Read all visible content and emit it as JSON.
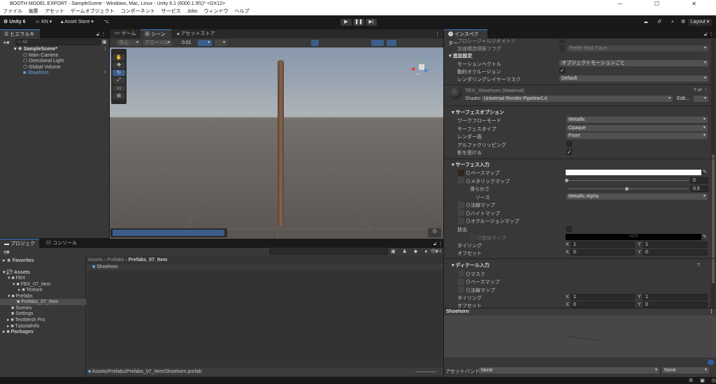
{
  "window": {
    "title": "BOOTH MODEL EXPORT - SampleScene - Windows, Mac, Linux - Unity 6.1 (6000.1.5f1)* <DX12>",
    "controls": "─ ☐ ✕"
  },
  "menu": [
    "ファイル",
    "編集",
    "アセット",
    "ゲームオブジェクト",
    "コンポーネント",
    "サービス",
    "Jobs",
    "ウィンドウ",
    "ヘルプ"
  ],
  "toolbar": {
    "unity": "Unity 6",
    "account": "KN ▾",
    "asset_store": "Asset Store ▾",
    "layout": "Layout ▾"
  },
  "hierarchy": {
    "tab": "ヒエラルキー",
    "search_placeholder": "All",
    "scene": "SampleScene*",
    "items": [
      "Main Camera",
      "Directional Light",
      "Global Volume",
      "Shoehorn"
    ]
  },
  "scene": {
    "tabs": [
      "ゲーム",
      "シーン",
      "アセットストア"
    ],
    "pivot": "中心",
    "space": "グローバル",
    "snap": "0.01"
  },
  "project": {
    "tabs": [
      "プロジェクト",
      "コンソール"
    ],
    "tree": {
      "favorites": "Favorites",
      "assets": "Assets",
      "fbx": "FBX",
      "fbx_item": "FBX_07_Item",
      "texture": "Texture",
      "prefabs": "Prefabs",
      "prefabs_item": "Prefabs_07_Item",
      "scenes": "Scenes",
      "settings": "Settings",
      "textmesh": "TextMesh Pro",
      "tutorial": "TutorialInfo",
      "packages": "Packages"
    },
    "breadcrumb": [
      "Assets",
      "Prefabs",
      "Prefabs_07_Item"
    ],
    "asset": "Shoehorn",
    "path": "Assets/Prefabs/Prefabs_07_Item/Shoehorn.prefab",
    "count": "24"
  },
  "inspector": {
    "tab": "インスペクター",
    "procedural": "プロシージャルジオメトリ",
    "accel": "加速構造構築フラグ",
    "accel_value": "Prefer Fast Trace",
    "additional": "追加設定",
    "motion": "モーションベクトル",
    "motion_value": "オブジェクトモーションごと",
    "occlusion": "動的オクルージョン",
    "layer_mask": "レンダリングレイヤーマスク",
    "layer_mask_value": "Default",
    "material": "TEX_Shoehorn (Material)",
    "shader_label": "Shader",
    "shader": "Universal Render Pipeline/Lit",
    "edit": "Edit...",
    "surface_options": "サーフェスオプション",
    "workflow": "ワークフローモード",
    "workflow_value": "Metallic",
    "surface_type": "サーフェスタイプ",
    "surface_type_value": "Opaque",
    "render_face": "レンダー面",
    "render_face_value": "Front",
    "alpha_clip": "アルファクリッピング",
    "receive_shadows": "影を受ける",
    "surface_inputs": "サーフェス入力",
    "base_map": "ベースマップ",
    "metallic_map": "メタリックマップ",
    "metallic_value": "0",
    "smoothness": "滑らかさ",
    "smoothness_value": "0.5",
    "source": "ソース",
    "source_value": "Metallic Alpha",
    "normal_map": "法線マップ",
    "height_map": "ハイトマップ",
    "occlusion_map": "オクルージョンマップ",
    "emission": "放出",
    "emission_map": "放出マップ",
    "hdr": "HDR",
    "tiling": "タイリング",
    "offset": "オフセット",
    "x": "X",
    "y": "Y",
    "one": "1",
    "zero": "0",
    "detail_inputs": "ディテール入力",
    "mask": "マスク",
    "detail_base": "ベースマップ",
    "detail_normal": "法線マップ",
    "preview_title": "Shoehorn",
    "asset_bundle": "アセットバンドル",
    "bundle_value": "None",
    "bundle_variant": "None"
  }
}
